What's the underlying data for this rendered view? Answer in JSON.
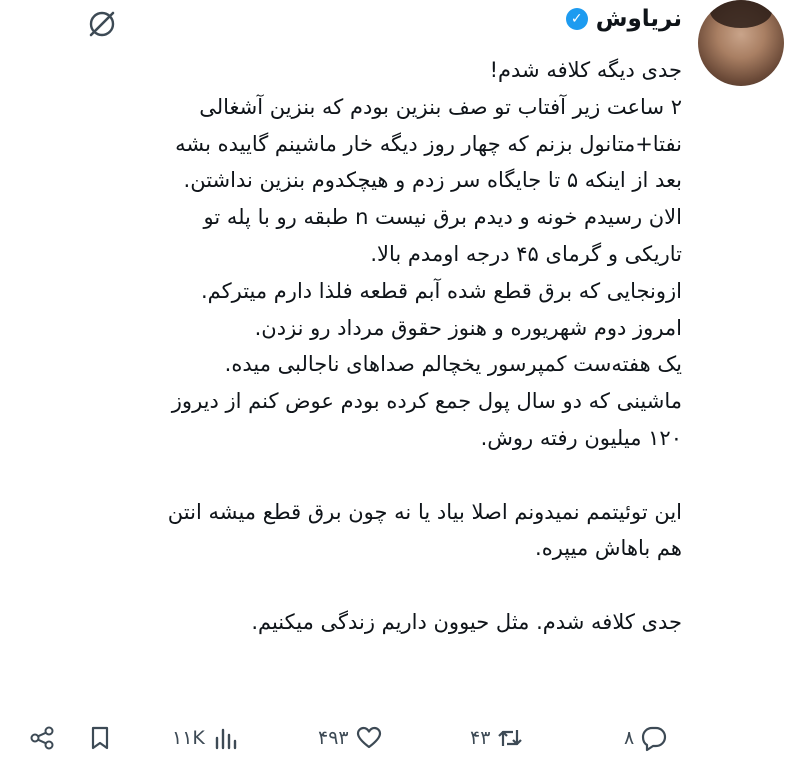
{
  "author": {
    "name": "نریاوش",
    "verified": true
  },
  "tweet": {
    "lines": [
      "جدی دیگه کلافه شدم!",
      "۲ ساعت زیر آفتاب تو صف بنزین بودم که بنزین آشغالی",
      "نفتا+متانول بزنم که چهار روز دیگه خار ماشینم گاییده بشه",
      "بعد از اینکه ۵ تا جایگاه سر زدم و هیچکدوم بنزین نداشتن.",
      "الان رسیدم خونه و دیدم برق نیست n طبقه رو با پله تو",
      "تاریکی و گرمای ۴۵ درجه اومدم بالا.",
      "ازونجایی که برق قطع شده آبم قطعه فلذا دارم میترکم.",
      "امروز دوم شهریوره و هنوز حقوق مرداد رو نزدن.",
      "یک هفته‌ست کمپرسور یخچالم صداهای ناجالبی میده.",
      "ماشینی که دو سال پول جمع کرده بودم عوض کنم از دیروز",
      "۱۲۰ میلیون رفته روش.",
      "",
      "این توئیتمم نمیدونم اصلا بیاد یا نه چون برق قطع میشه انتن",
      "هم باهاش میپره.",
      "",
      "جدی کلافه شدم. مثل حیوون داریم زندگی میکنیم."
    ]
  },
  "actions": {
    "replies": "۸",
    "retweets": "۴۳",
    "likes": "۴۹۳",
    "views": "۱۱K"
  },
  "colors": {
    "verified": "#1d9bf0",
    "icon": "#3d4a55"
  }
}
